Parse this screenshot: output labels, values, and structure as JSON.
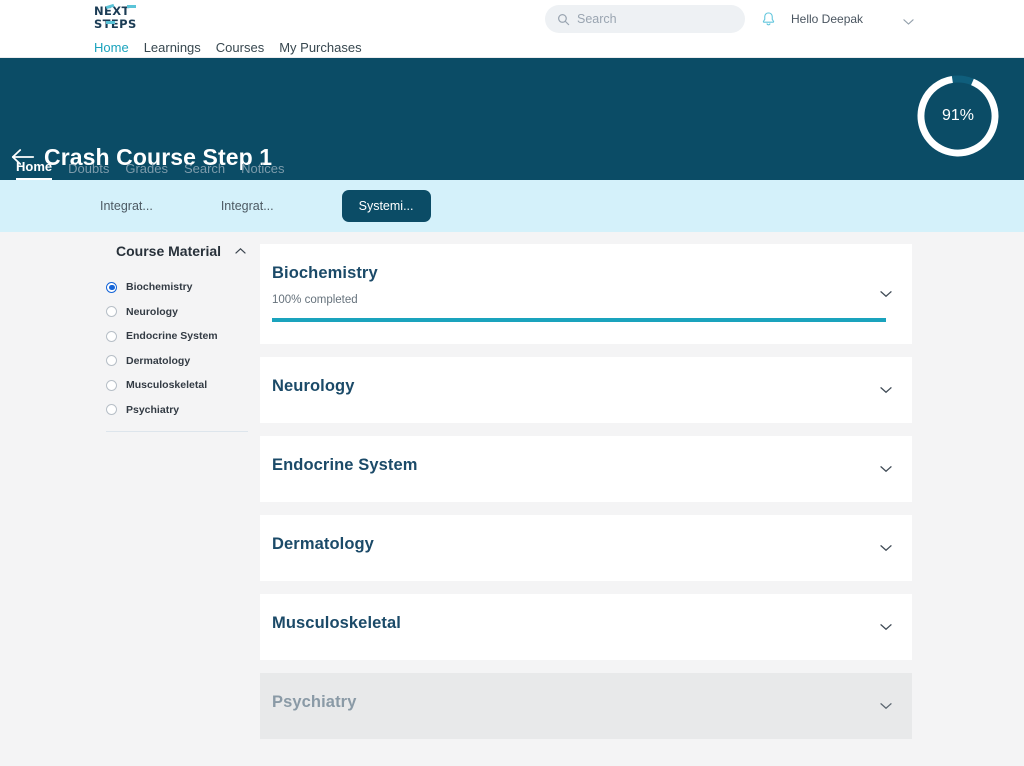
{
  "colors": {
    "header_bg": "#0b4c66",
    "chip_bar_bg": "#d4f1fa",
    "accent_teal": "#1aa3bd",
    "page_bg": "#f4f4f5",
    "radio_blue": "#1565d8",
    "disabled_card_bg": "#e8e9ea"
  },
  "topbar": {
    "logo": {
      "line1": "NEXT",
      "line2": "STEPS",
      "name": "next-steps-logo"
    },
    "nav": [
      {
        "label": "Home",
        "active": true
      },
      {
        "label": "Learnings",
        "active": false
      },
      {
        "label": "Courses",
        "active": false
      },
      {
        "label": "My Purchases",
        "active": false
      }
    ],
    "search": {
      "placeholder": "Search",
      "value": "",
      "icon": "search-icon"
    },
    "bell_icon": "bell-icon",
    "greeting": "Hello Deepak",
    "user_caret_icon": "chevron-down-icon"
  },
  "course_header": {
    "back_icon": "arrow-left-icon",
    "title": "Crash Course Step 1",
    "progress": {
      "percent_label": "91%",
      "value": 91
    },
    "tabs": [
      {
        "label": "Home",
        "active": true
      },
      {
        "label": "Doubts",
        "active": false
      },
      {
        "label": "Grades",
        "active": false
      },
      {
        "label": "Search",
        "active": false
      },
      {
        "label": "Notices",
        "active": false
      }
    ]
  },
  "chipbar": {
    "chips": [
      {
        "label": "Integrat...",
        "active": false
      },
      {
        "label": "Integrat...",
        "active": false
      },
      {
        "label": "Systemi...",
        "active": true
      }
    ]
  },
  "sidebar": {
    "title": "Course Material",
    "collapse_icon": "chevron-up-icon",
    "items": [
      {
        "label": "Biochemistry",
        "selected": true
      },
      {
        "label": "Neurology",
        "selected": false
      },
      {
        "label": "Endocrine System",
        "selected": false
      },
      {
        "label": "Dermatology",
        "selected": false
      },
      {
        "label": "Musculoskeletal",
        "selected": false
      },
      {
        "label": "Psychiatry",
        "selected": false
      }
    ]
  },
  "cards": [
    {
      "title": "Biochemistry",
      "subtitle": "100% completed",
      "progress": 100,
      "has_progress": true,
      "disabled": false,
      "caret_icon": "chevron-down-icon"
    },
    {
      "title": "Neurology",
      "subtitle": "",
      "progress": 0,
      "has_progress": false,
      "disabled": false,
      "caret_icon": "chevron-down-icon"
    },
    {
      "title": "Endocrine System",
      "subtitle": "",
      "progress": 0,
      "has_progress": false,
      "disabled": false,
      "caret_icon": "chevron-down-icon"
    },
    {
      "title": "Dermatology",
      "subtitle": "",
      "progress": 0,
      "has_progress": false,
      "disabled": false,
      "caret_icon": "chevron-down-icon"
    },
    {
      "title": "Musculoskeletal",
      "subtitle": "",
      "progress": 0,
      "has_progress": false,
      "disabled": false,
      "caret_icon": "chevron-down-icon"
    },
    {
      "title": "Psychiatry",
      "subtitle": "",
      "progress": 0,
      "has_progress": false,
      "disabled": true,
      "caret_icon": "chevron-down-icon"
    }
  ]
}
